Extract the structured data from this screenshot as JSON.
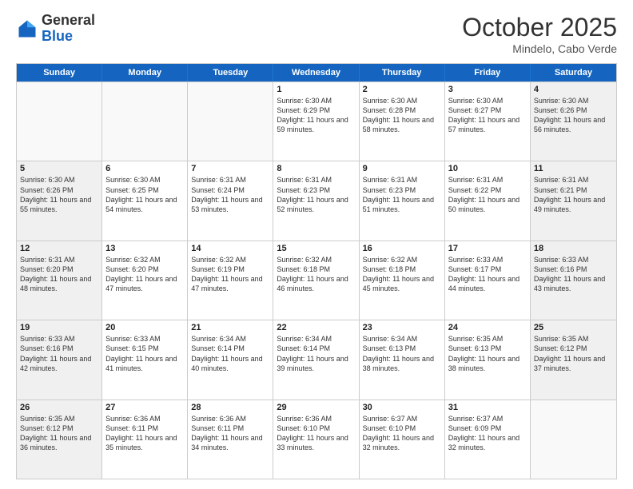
{
  "header": {
    "logo_general": "General",
    "logo_blue": "Blue",
    "month": "October 2025",
    "location": "Mindelo, Cabo Verde"
  },
  "weekdays": [
    "Sunday",
    "Monday",
    "Tuesday",
    "Wednesday",
    "Thursday",
    "Friday",
    "Saturday"
  ],
  "rows": [
    [
      {
        "day": "",
        "info": "",
        "empty": true
      },
      {
        "day": "",
        "info": "",
        "empty": true
      },
      {
        "day": "",
        "info": "",
        "empty": true
      },
      {
        "day": "1",
        "info": "Sunrise: 6:30 AM\nSunset: 6:29 PM\nDaylight: 11 hours\nand 59 minutes."
      },
      {
        "day": "2",
        "info": "Sunrise: 6:30 AM\nSunset: 6:28 PM\nDaylight: 11 hours\nand 58 minutes."
      },
      {
        "day": "3",
        "info": "Sunrise: 6:30 AM\nSunset: 6:27 PM\nDaylight: 11 hours\nand 57 minutes."
      },
      {
        "day": "4",
        "info": "Sunrise: 6:30 AM\nSunset: 6:26 PM\nDaylight: 11 hours\nand 56 minutes.",
        "shaded": true
      }
    ],
    [
      {
        "day": "5",
        "info": "Sunrise: 6:30 AM\nSunset: 6:26 PM\nDaylight: 11 hours\nand 55 minutes.",
        "shaded": true
      },
      {
        "day": "6",
        "info": "Sunrise: 6:30 AM\nSunset: 6:25 PM\nDaylight: 11 hours\nand 54 minutes."
      },
      {
        "day": "7",
        "info": "Sunrise: 6:31 AM\nSunset: 6:24 PM\nDaylight: 11 hours\nand 53 minutes."
      },
      {
        "day": "8",
        "info": "Sunrise: 6:31 AM\nSunset: 6:23 PM\nDaylight: 11 hours\nand 52 minutes."
      },
      {
        "day": "9",
        "info": "Sunrise: 6:31 AM\nSunset: 6:23 PM\nDaylight: 11 hours\nand 51 minutes."
      },
      {
        "day": "10",
        "info": "Sunrise: 6:31 AM\nSunset: 6:22 PM\nDaylight: 11 hours\nand 50 minutes."
      },
      {
        "day": "11",
        "info": "Sunrise: 6:31 AM\nSunset: 6:21 PM\nDaylight: 11 hours\nand 49 minutes.",
        "shaded": true
      }
    ],
    [
      {
        "day": "12",
        "info": "Sunrise: 6:31 AM\nSunset: 6:20 PM\nDaylight: 11 hours\nand 48 minutes.",
        "shaded": true
      },
      {
        "day": "13",
        "info": "Sunrise: 6:32 AM\nSunset: 6:20 PM\nDaylight: 11 hours\nand 47 minutes."
      },
      {
        "day": "14",
        "info": "Sunrise: 6:32 AM\nSunset: 6:19 PM\nDaylight: 11 hours\nand 47 minutes."
      },
      {
        "day": "15",
        "info": "Sunrise: 6:32 AM\nSunset: 6:18 PM\nDaylight: 11 hours\nand 46 minutes."
      },
      {
        "day": "16",
        "info": "Sunrise: 6:32 AM\nSunset: 6:18 PM\nDaylight: 11 hours\nand 45 minutes."
      },
      {
        "day": "17",
        "info": "Sunrise: 6:33 AM\nSunset: 6:17 PM\nDaylight: 11 hours\nand 44 minutes."
      },
      {
        "day": "18",
        "info": "Sunrise: 6:33 AM\nSunset: 6:16 PM\nDaylight: 11 hours\nand 43 minutes.",
        "shaded": true
      }
    ],
    [
      {
        "day": "19",
        "info": "Sunrise: 6:33 AM\nSunset: 6:16 PM\nDaylight: 11 hours\nand 42 minutes.",
        "shaded": true
      },
      {
        "day": "20",
        "info": "Sunrise: 6:33 AM\nSunset: 6:15 PM\nDaylight: 11 hours\nand 41 minutes."
      },
      {
        "day": "21",
        "info": "Sunrise: 6:34 AM\nSunset: 6:14 PM\nDaylight: 11 hours\nand 40 minutes."
      },
      {
        "day": "22",
        "info": "Sunrise: 6:34 AM\nSunset: 6:14 PM\nDaylight: 11 hours\nand 39 minutes."
      },
      {
        "day": "23",
        "info": "Sunrise: 6:34 AM\nSunset: 6:13 PM\nDaylight: 11 hours\nand 38 minutes."
      },
      {
        "day": "24",
        "info": "Sunrise: 6:35 AM\nSunset: 6:13 PM\nDaylight: 11 hours\nand 38 minutes."
      },
      {
        "day": "25",
        "info": "Sunrise: 6:35 AM\nSunset: 6:12 PM\nDaylight: 11 hours\nand 37 minutes.",
        "shaded": true
      }
    ],
    [
      {
        "day": "26",
        "info": "Sunrise: 6:35 AM\nSunset: 6:12 PM\nDaylight: 11 hours\nand 36 minutes.",
        "shaded": true
      },
      {
        "day": "27",
        "info": "Sunrise: 6:36 AM\nSunset: 6:11 PM\nDaylight: 11 hours\nand 35 minutes."
      },
      {
        "day": "28",
        "info": "Sunrise: 6:36 AM\nSunset: 6:11 PM\nDaylight: 11 hours\nand 34 minutes."
      },
      {
        "day": "29",
        "info": "Sunrise: 6:36 AM\nSunset: 6:10 PM\nDaylight: 11 hours\nand 33 minutes."
      },
      {
        "day": "30",
        "info": "Sunrise: 6:37 AM\nSunset: 6:10 PM\nDaylight: 11 hours\nand 32 minutes."
      },
      {
        "day": "31",
        "info": "Sunrise: 6:37 AM\nSunset: 6:09 PM\nDaylight: 11 hours\nand 32 minutes."
      },
      {
        "day": "",
        "info": "",
        "empty": true,
        "shaded": true
      }
    ]
  ]
}
